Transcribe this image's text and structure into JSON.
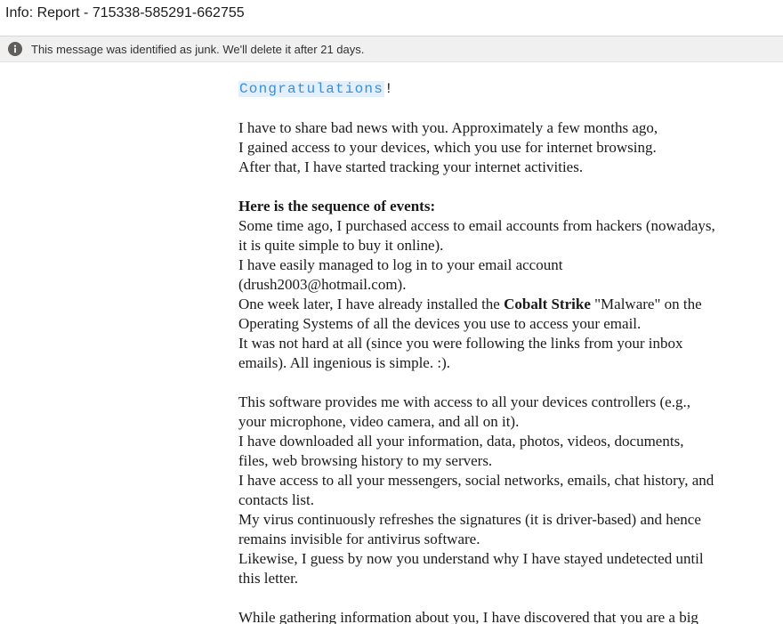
{
  "window": {
    "subject": "Info: Report - 715338-585291-662755"
  },
  "junk_banner": {
    "icon": "info-icon",
    "text": "This message was identified as junk. We'll delete it after 21 days."
  },
  "message": {
    "greeting_word": "Congratulations",
    "greeting_punct": "!",
    "p1": [
      "I have to share bad news with you. Approximately a few months ago,",
      "I gained access to your devices, which you use for internet browsing.",
      "After that, I have started tracking your internet activities."
    ],
    "p2_heading": "Here is the sequence of events:",
    "p2_l1": "Some time ago, I purchased access to email accounts from hackers (nowadays,",
    "p2_l2": "it is quite simple to buy it online).",
    "p2_l3": "I have easily managed to log in to your email account",
    "p2_l4": "(drush2003@hotmail.com).",
    "p2_l5_pre": "One week later, I have already installed the ",
    "p2_l5_bold": "Cobalt Strike",
    "p2_l5_post": " \"Malware\" on the",
    "p2_l6": "Operating Systems of all the devices you use to access your email.",
    "p2_l7": "It was not hard at all (since you were following the links from your inbox",
    "p2_l8": "emails). All ingenious is simple. :).",
    "p3": [
      "This software provides me with access to all your devices controllers (e.g.,",
      "your microphone, video camera, and all on it).",
      "I have downloaded all your information, data, photos, videos, documents,",
      "files, web browsing history to my servers.",
      "I have access to all your messengers, social networks, emails, chat history, and",
      "contacts list.",
      "My virus continuously refreshes the signatures (it is driver-based) and hence",
      "remains invisible for antivirus software.",
      "Likewise, I guess by now you understand why I have stayed undetected until",
      "this letter."
    ],
    "p4": [
      "While gathering information about you, I have discovered that you are a big"
    ]
  }
}
